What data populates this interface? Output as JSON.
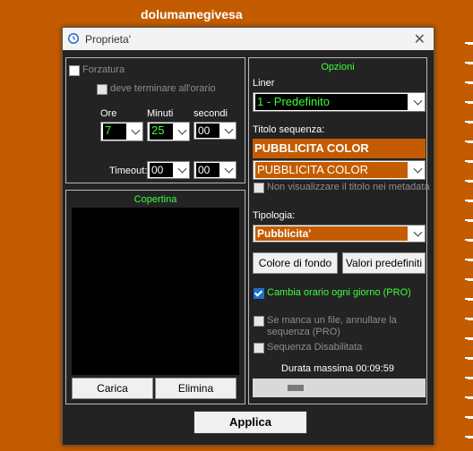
{
  "background": {
    "title": "dolumamegivesa",
    "color": "#c35c00"
  },
  "dialog": {
    "title": "Proprieta'",
    "icon": "clock-icon",
    "close_icon": "close-icon"
  },
  "left": {
    "forzatura_label": "Forzatura",
    "deve_label": "deve terminare all'orario",
    "ore_label": "Ore",
    "minuti_label": "Minuti",
    "secondi_label": "secondi",
    "ore_value": "7",
    "minuti_value": "25",
    "secondi_value": "00",
    "timeout_label": "Timeout:",
    "timeout_min_value": "00",
    "timeout_sec_value": "00"
  },
  "copertina": {
    "title": "Copertina",
    "carica_label": "Carica",
    "elimina_label": "Elimina"
  },
  "opzioni": {
    "title": "Opzioni",
    "liner_label": "Liner",
    "liner_value": "1 - Predefinito",
    "titolo_label": "Titolo sequenza:",
    "titolo_display": "PUBBLICITA COLOR",
    "titolo_select_value": "PUBBLICITA COLOR",
    "non_visualizzare_label": "Non visualizzare il titolo nei metadata",
    "tipologia_label": "Tipologia:",
    "tipologia_value": "Pubblicita'",
    "colore_button": "Colore di fondo",
    "valori_button": "Valori predefiniti",
    "cambia_label": "Cambia orario ogni giorno (PRO)",
    "se_manca_line1": "Se manca un file, annullare la",
    "se_manca_line2": "sequenza (PRO)",
    "sequenza_label": "Sequenza Disabilitata",
    "durata_label": "Durata massima 00:09:59"
  },
  "footer": {
    "applica_label": "Applica"
  },
  "colors": {
    "accent_green": "#3bff3b",
    "orange": "#c35c00",
    "dialog_bg": "#232323"
  }
}
